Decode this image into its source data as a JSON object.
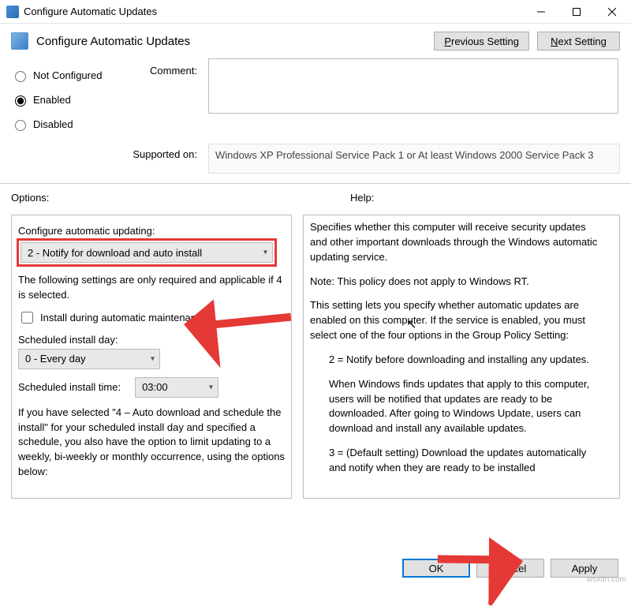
{
  "titlebar": {
    "title": "Configure Automatic Updates"
  },
  "header": {
    "title": "Configure Automatic Updates",
    "prev_p": "P",
    "prev_rest": "revious Setting",
    "next_n": "N",
    "next_rest": "ext Setting"
  },
  "radios": {
    "not_configured": "Not Configured",
    "enabled": "Enabled",
    "disabled": "Disabled",
    "selected": "enabled"
  },
  "labels": {
    "comment": "Comment:",
    "supported": "Supported on:",
    "options": "Options:",
    "help": "Help:"
  },
  "supported_text": "Windows XP Professional Service Pack 1 or At least Windows 2000 Service Pack 3",
  "options": {
    "cfg_label": "Configure automatic updating:",
    "cfg_value": "2 - Notify for download and auto install",
    "note1": "The following settings are only required and applicable if 4 is selected.",
    "chk_label": "Install during automatic maintenance",
    "day_label": "Scheduled install day:",
    "day_value": "0 - Every day",
    "time_label": "Scheduled install time:",
    "time_value": "03:00",
    "note2": "If you have selected \"4 – Auto download and schedule the install\" for your scheduled install day and specified a schedule, you also have the option to limit updating to a weekly, bi-weekly or monthly occurrence, using the options below:"
  },
  "help": {
    "p1": "Specifies whether this computer will receive security updates and other important downloads through the Windows automatic updating service.",
    "p2": "Note: This policy does not apply to Windows RT.",
    "p3": "This setting lets you specify whether automatic updates are enabled on this computer. If the service is enabled, you must select one of the four options in the Group Policy Setting:",
    "p4": "2 = Notify before downloading and installing any updates.",
    "p5": "When Windows finds updates that apply to this computer, users will be notified that updates are ready to be downloaded. After going to Windows Update, users can download and install any available updates.",
    "p6": "3 = (Default setting) Download the updates automatically and notify when they are ready to be installed"
  },
  "footer": {
    "ok": "OK",
    "cancel": "Cancel",
    "apply": "Apply"
  },
  "watermark": "wsxdn.com"
}
